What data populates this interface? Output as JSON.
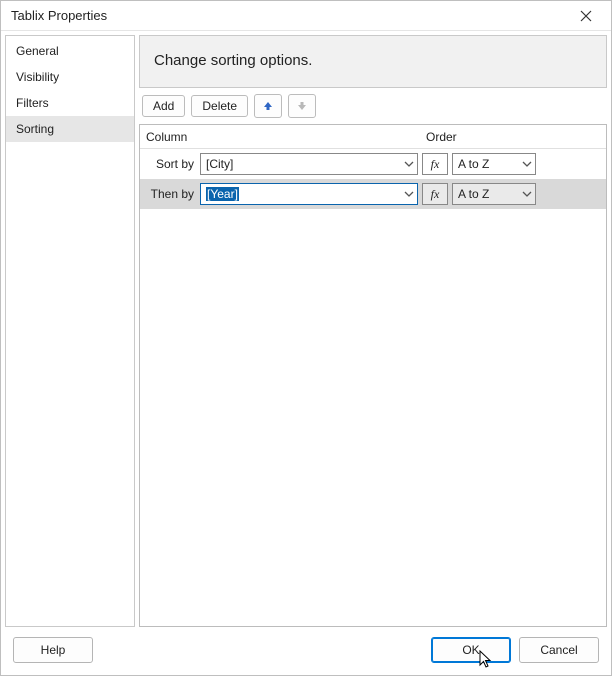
{
  "window": {
    "title": "Tablix Properties"
  },
  "sidebar": {
    "items": [
      {
        "label": "General"
      },
      {
        "label": "Visibility"
      },
      {
        "label": "Filters"
      },
      {
        "label": "Sorting"
      }
    ],
    "selectedIndex": 3
  },
  "header": {
    "title": "Change sorting options."
  },
  "toolbar": {
    "add_label": "Add",
    "delete_label": "Delete"
  },
  "grid": {
    "headers": {
      "column": "Column",
      "order": "Order"
    },
    "rows": [
      {
        "label": "Sort by",
        "column_value": "[City]",
        "order_value": "A to Z",
        "selected": false
      },
      {
        "label": "Then by",
        "column_value": "[Year]",
        "order_value": "A to Z",
        "selected": true
      }
    ]
  },
  "footer": {
    "help_label": "Help",
    "ok_label": "OK",
    "cancel_label": "Cancel"
  },
  "fx_label": "fx"
}
